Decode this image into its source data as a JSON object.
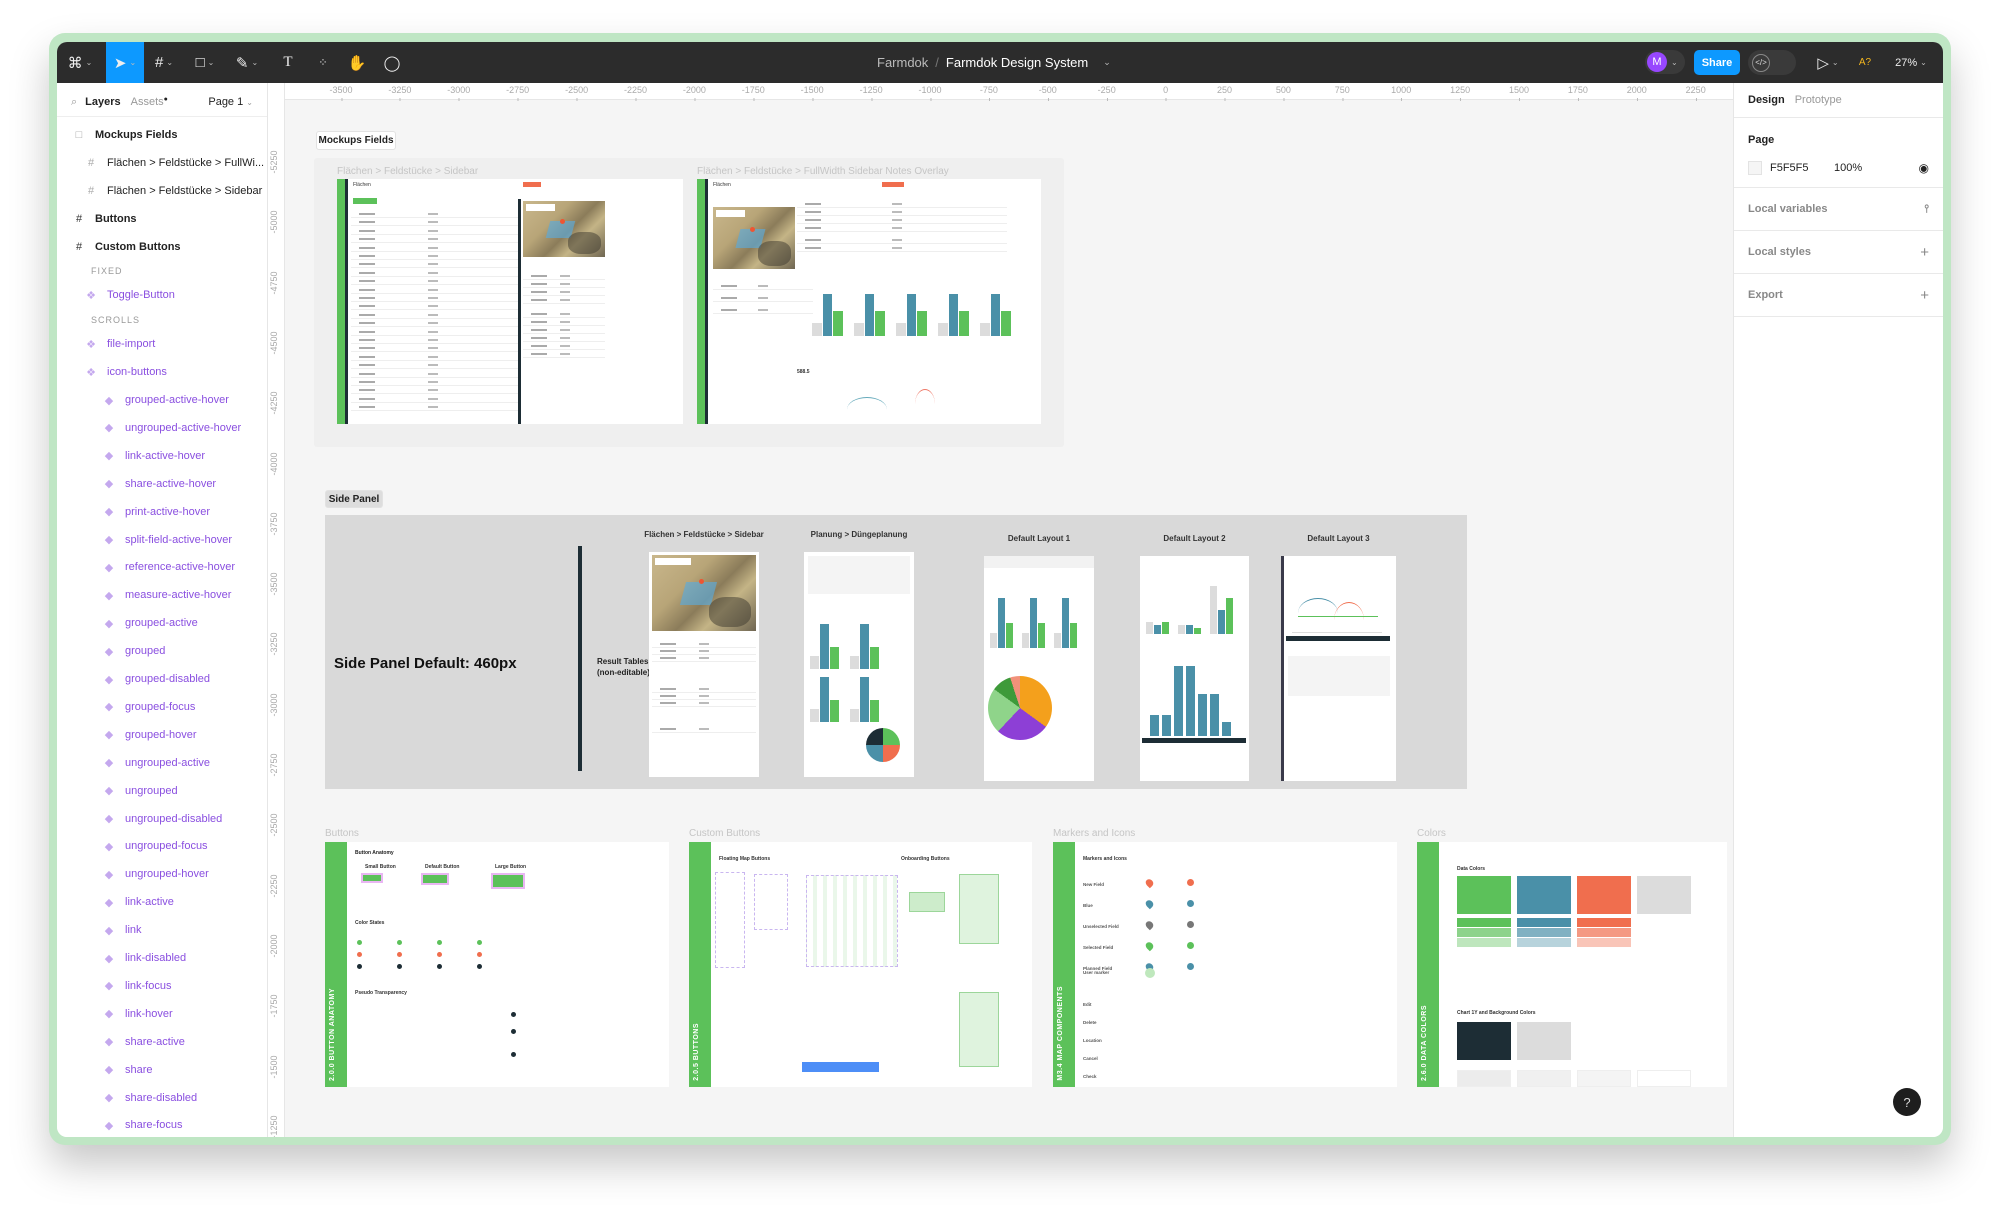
{
  "toolbar": {
    "project": "Farmdok",
    "separator": "/",
    "file": "Farmdok Design System",
    "avatar_initial": "M",
    "share_label": "Share",
    "ai_label": "A?",
    "zoom": "27%",
    "active_tool": "move",
    "colors": {
      "bg": "#2c2c2c",
      "accent": "#0d99ff",
      "avatar": "#9747ff"
    }
  },
  "layers_panel": {
    "tabs": [
      "Layers",
      "Assets"
    ],
    "page": "Page 1",
    "items": [
      {
        "label": "Mockups Fields",
        "type": "section",
        "indent": 0
      },
      {
        "label": "Flächen > Feldstücke > FullWi...",
        "type": "frame",
        "indent": 1
      },
      {
        "label": "Flächen > Feldstücke > Sidebar",
        "type": "frame",
        "indent": 1
      },
      {
        "label": "Buttons",
        "type": "frame-bold",
        "indent": 0
      },
      {
        "label": "Custom Buttons",
        "type": "frame-bold",
        "indent": 0
      },
      {
        "label": "FIXED",
        "type": "heading",
        "indent": 1
      },
      {
        "label": "Toggle-Button",
        "type": "component-set",
        "indent": 1
      },
      {
        "label": "SCROLLS",
        "type": "heading",
        "indent": 1
      },
      {
        "label": "file-import",
        "type": "component-set",
        "indent": 1
      },
      {
        "label": "icon-buttons",
        "type": "component-set",
        "indent": 1
      },
      {
        "label": "grouped-active-hover",
        "type": "component",
        "indent": 2
      },
      {
        "label": "ungrouped-active-hover",
        "type": "component",
        "indent": 2
      },
      {
        "label": "link-active-hover",
        "type": "component",
        "indent": 2
      },
      {
        "label": "share-active-hover",
        "type": "component",
        "indent": 2
      },
      {
        "label": "print-active-hover",
        "type": "component",
        "indent": 2
      },
      {
        "label": "split-field-active-hover",
        "type": "component",
        "indent": 2
      },
      {
        "label": "reference-active-hover",
        "type": "component",
        "indent": 2
      },
      {
        "label": "measure-active-hover",
        "type": "component",
        "indent": 2
      },
      {
        "label": "grouped-active",
        "type": "component",
        "indent": 2
      },
      {
        "label": "grouped",
        "type": "component",
        "indent": 2
      },
      {
        "label": "grouped-disabled",
        "type": "component",
        "indent": 2
      },
      {
        "label": "grouped-focus",
        "type": "component",
        "indent": 2
      },
      {
        "label": "grouped-hover",
        "type": "component",
        "indent": 2
      },
      {
        "label": "ungrouped-active",
        "type": "component",
        "indent": 2
      },
      {
        "label": "ungrouped",
        "type": "component",
        "indent": 2
      },
      {
        "label": "ungrouped-disabled",
        "type": "component",
        "indent": 2
      },
      {
        "label": "ungrouped-focus",
        "type": "component",
        "indent": 2
      },
      {
        "label": "ungrouped-hover",
        "type": "component",
        "indent": 2
      },
      {
        "label": "link-active",
        "type": "component",
        "indent": 2
      },
      {
        "label": "link",
        "type": "component",
        "indent": 2
      },
      {
        "label": "link-disabled",
        "type": "component",
        "indent": 2
      },
      {
        "label": "link-focus",
        "type": "component",
        "indent": 2
      },
      {
        "label": "link-hover",
        "type": "component",
        "indent": 2
      },
      {
        "label": "share-active",
        "type": "component",
        "indent": 2
      },
      {
        "label": "share",
        "type": "component",
        "indent": 2
      },
      {
        "label": "share-disabled",
        "type": "component",
        "indent": 2
      },
      {
        "label": "share-focus",
        "type": "component",
        "indent": 2
      }
    ]
  },
  "rulers": {
    "horizontal": [
      "-3500",
      "-3250",
      "-3000",
      "-2750",
      "-2500",
      "-2250",
      "-2000",
      "-1750",
      "-1500",
      "-1250",
      "-1000",
      "-750",
      "-500",
      "-250",
      "0",
      "250",
      "500",
      "750",
      "1000",
      "1250",
      "1500",
      "1750",
      "2000",
      "2250"
    ],
    "vertical": [
      "-5250",
      "-5000",
      "-4750",
      "-4500",
      "-4250",
      "-4000",
      "-3750",
      "-3500",
      "-3250",
      "-3000",
      "-2750",
      "-2500",
      "-2250",
      "-2000",
      "-1750",
      "-1500",
      "-1250"
    ]
  },
  "design_panel": {
    "tabs": [
      "Design",
      "Prototype"
    ],
    "page_label": "Page",
    "page_color": "F5F5F5",
    "page_opacity": "100%",
    "local_variables": "Local variables",
    "local_styles": "Local styles",
    "export": "Export"
  },
  "canvas": {
    "mockups": {
      "label": "Mockups Fields",
      "frames": [
        "Flächen > Feldstücke > Sidebar",
        "Flächen > Feldstücke > FullWidth Sidebar Notes Overlay"
      ],
      "header": "Flächen"
    },
    "side_panel": {
      "label": "Side Panel",
      "heading": "Side Panel Default: 460px",
      "note": "Result Tables (non-editable)",
      "cards": [
        "Flächen > Feldstücke > Sidebar",
        "Planung > Düngeplanung",
        "Default Layout 1",
        "Default Layout 2",
        "Default Layout 3"
      ]
    },
    "buttons": {
      "label": "Buttons",
      "strip": "2.0.0 BUTTON ANATOMY",
      "anatomy": "Button Anatomy",
      "sizes": [
        "Small Button",
        "Default Button",
        "Large Button"
      ],
      "color_states": "Color States",
      "pseudo": "Pseudo Transparency"
    },
    "custom_buttons": {
      "label": "Custom Buttons",
      "strip": "2.0.5 BUTTONS",
      "floating": "Floating Map Buttons",
      "onboarding": "Onboarding Buttons"
    },
    "markers": {
      "label": "Markers and Icons",
      "strip": "M3.4 MAP COMPONENTS",
      "title": "Markers and Icons",
      "rows": [
        "New Field",
        "Blue",
        "Unselected Field",
        "Selected Field",
        "Planned Field",
        "User marker",
        "Edit",
        "Delete",
        "Location",
        "Cancel",
        "Check"
      ]
    },
    "colors": {
      "label": "Colors",
      "strip": "2.6.0 DATA COLORS",
      "data_colors": "Data Colors",
      "chart_bg": "Chart 1Y and Background Colors",
      "swatches": [
        "#5cc15a",
        "#4a90a8",
        "#f06e4e",
        "#dcdcdc"
      ]
    }
  },
  "help_label": "?"
}
